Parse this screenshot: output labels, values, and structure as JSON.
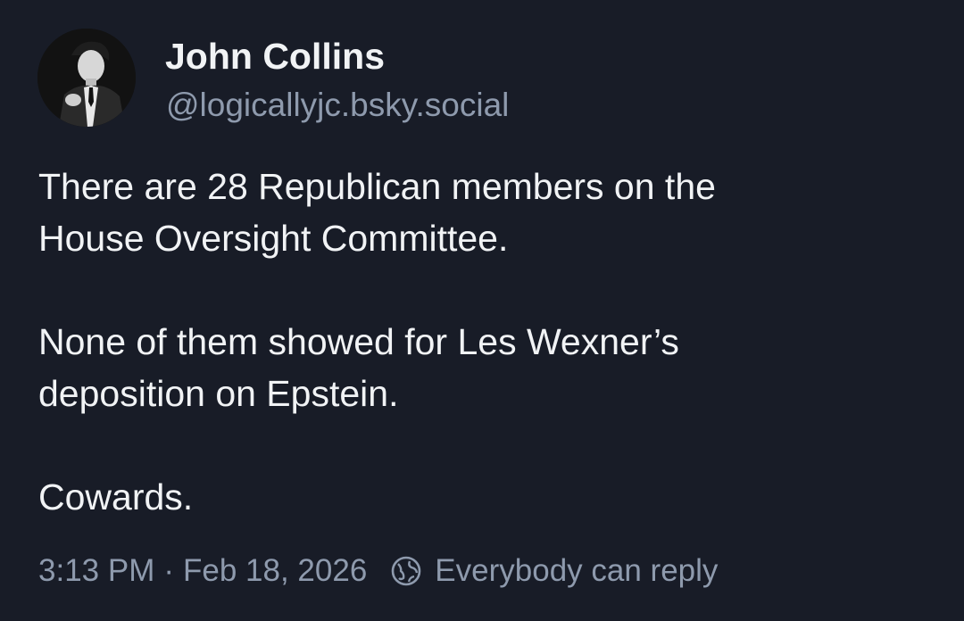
{
  "author": {
    "name": "John Collins",
    "handle": "@logicallyjc.bsky.social",
    "avatar_icon": "profile-photo"
  },
  "post": {
    "paragraphs": [
      [
        "There are 28 Republican members on the",
        "House Oversight Committee."
      ],
      [
        "None of them showed for Les Wexner’s",
        "deposition on Epstein."
      ],
      [
        "Cowards."
      ]
    ]
  },
  "meta": {
    "time": "3:13 PM",
    "separator": "·",
    "date": "Feb 18, 2026",
    "reply_setting_icon": "globe-icon",
    "reply_setting": "Everybody can reply"
  },
  "colors": {
    "background": "#181c27",
    "text": "#f1f3f5",
    "muted": "#8e9aad"
  }
}
